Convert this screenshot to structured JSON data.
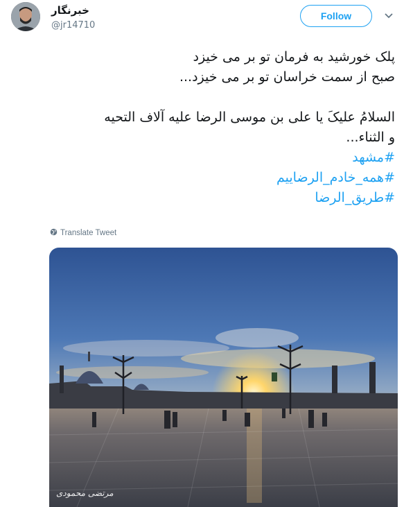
{
  "user": {
    "display_name": "خبرنگار",
    "handle": "@jr14710"
  },
  "follow_label": "Follow",
  "tweet": {
    "lines": [
      "پلک خورشید به فرمان تو بر می خیزد",
      "صبح از سمت خراسان تو بر می خیزد...",
      "السلامُ علیکَ یا علی بن موسی الرضا علیه آلاف التحیه",
      "و الثناء..."
    ],
    "hashtags": [
      "#مشهد",
      "#همه_خادم_الرضاییم",
      "#طریق_الرضا"
    ]
  },
  "translate_label": "Translate Tweet",
  "photo": {
    "signature": "مرتضی محمودی"
  },
  "colors": {
    "accent": "#1da1f2",
    "secondary_text": "#657786",
    "primary_text": "#14171a"
  },
  "icons": {
    "caret": "chevron-down-icon",
    "translate": "globe-icon"
  }
}
